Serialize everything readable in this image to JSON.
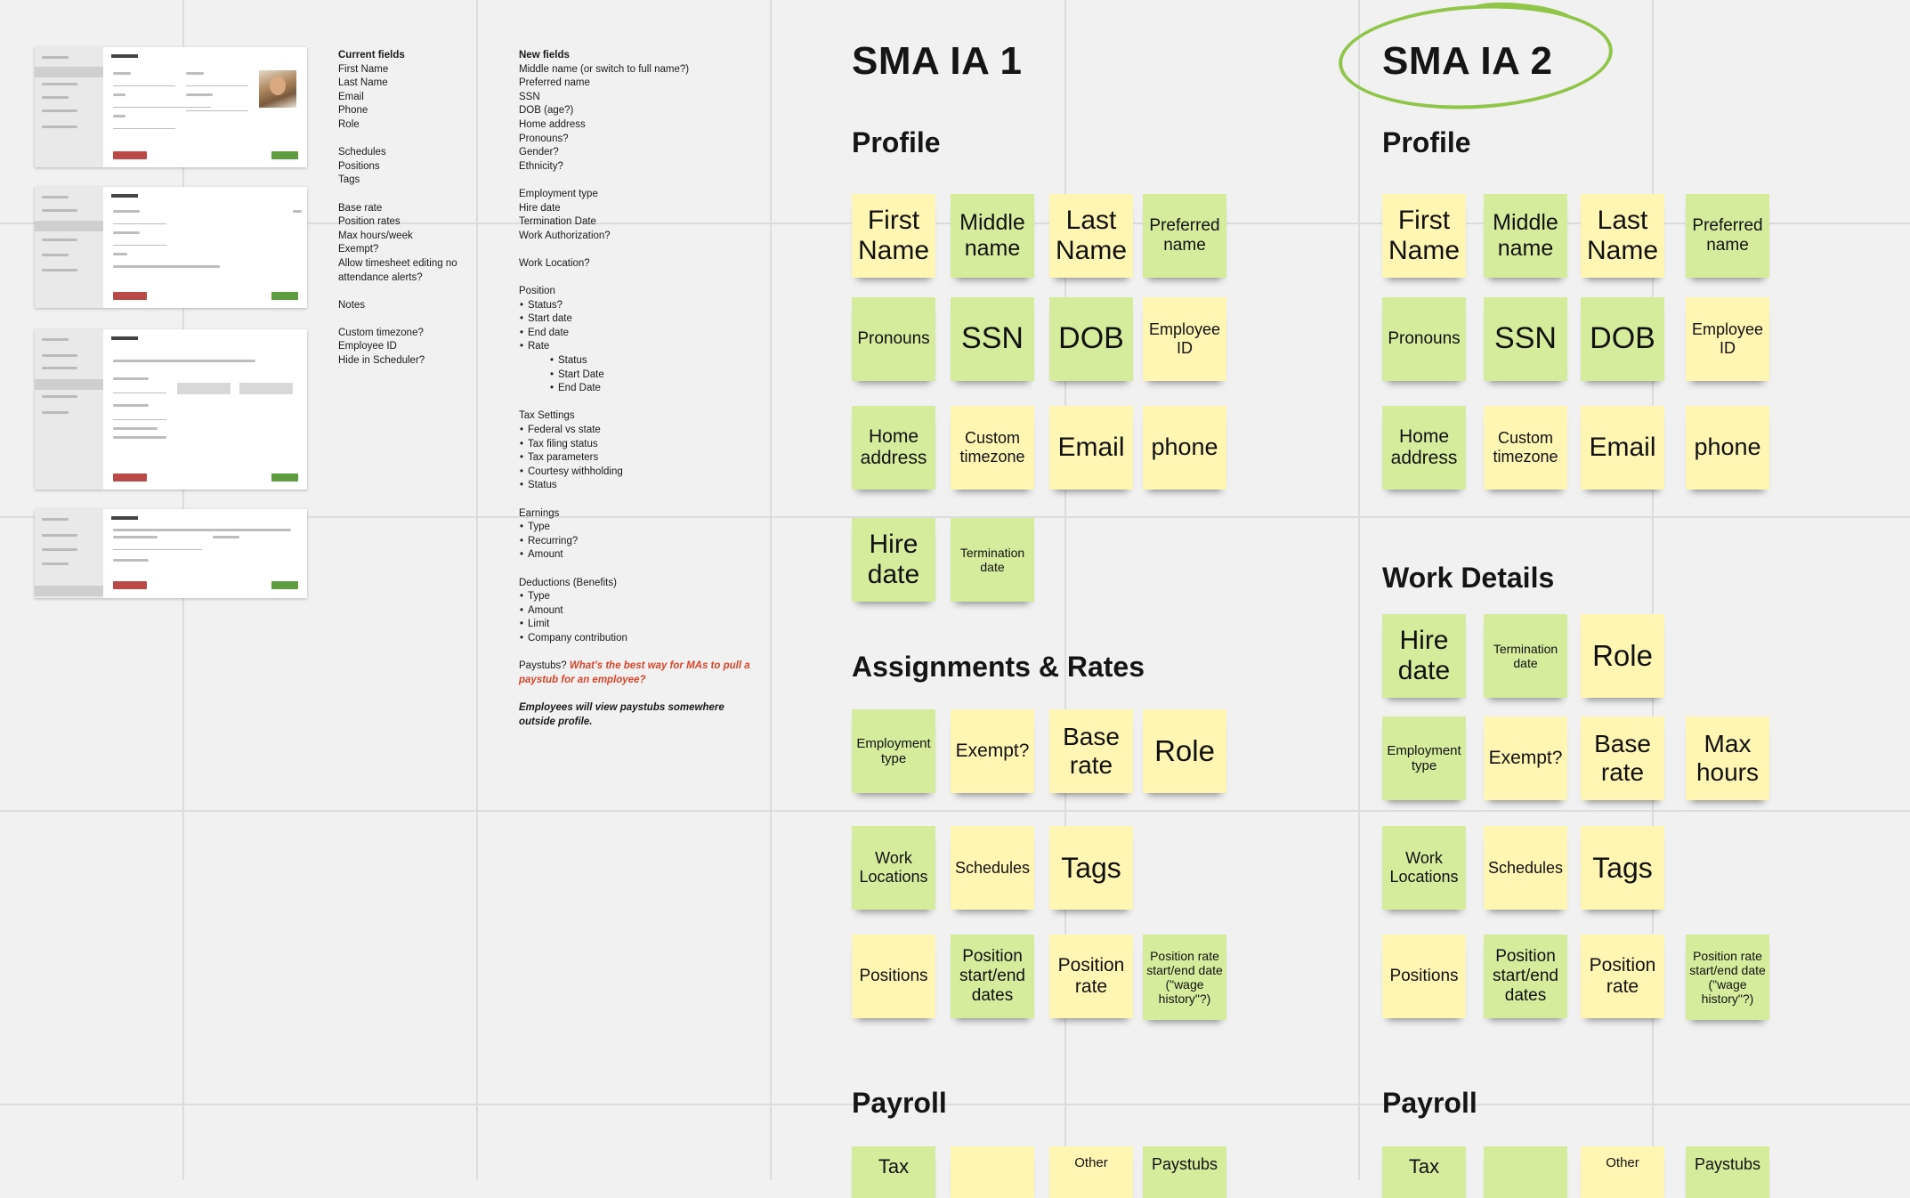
{
  "thumbnails": [
    "profile-form",
    "position-form",
    "rate-form",
    "tags-form"
  ],
  "current_fields": {
    "title": "Current fields",
    "items": [
      "First Name",
      "Last Name",
      "Email",
      "Phone",
      "Role",
      "",
      "Schedules",
      "Positions",
      "Tags",
      "",
      "Base rate",
      "Position rates",
      "Max hours/week",
      "Exempt?",
      "Allow timesheet editing no",
      "attendance alerts?",
      "",
      "Notes",
      "",
      "Custom timezone?",
      "Employee ID",
      "Hide in Scheduler?"
    ]
  },
  "new_fields": {
    "title": "New fields",
    "lines": [
      {
        "t": "Middle name (or switch to full name?)"
      },
      {
        "t": "Preferred name"
      },
      {
        "t": "SSN"
      },
      {
        "t": "DOB (age?)"
      },
      {
        "t": "Home address"
      },
      {
        "t": "Pronouns?"
      },
      {
        "t": "Gender?"
      },
      {
        "t": "Ethnicity?"
      },
      {
        "t": ""
      },
      {
        "t": "Employment type"
      },
      {
        "t": "Hire date"
      },
      {
        "t": "Termination Date"
      },
      {
        "t": "Work Authorization?"
      },
      {
        "t": ""
      },
      {
        "t": "Work Location?"
      },
      {
        "t": ""
      },
      {
        "t": "Position"
      },
      {
        "t": "Status?",
        "b": 1
      },
      {
        "t": "Start date",
        "b": 1
      },
      {
        "t": "End date",
        "b": 1
      },
      {
        "t": "Rate",
        "b": 1
      },
      {
        "t": "Status",
        "b": 2
      },
      {
        "t": "Start Date",
        "b": 2
      },
      {
        "t": "End Date",
        "b": 2
      },
      {
        "t": ""
      },
      {
        "t": "Tax Settings"
      },
      {
        "t": "Federal vs state",
        "b": 1
      },
      {
        "t": "Tax filing status",
        "b": 1
      },
      {
        "t": "Tax parameters",
        "b": 1
      },
      {
        "t": "Courtesy withholding",
        "b": 1
      },
      {
        "t": "Status",
        "b": 1
      },
      {
        "t": ""
      },
      {
        "t": "Earnings"
      },
      {
        "t": "Type",
        "b": 1
      },
      {
        "t": "Recurring?",
        "b": 1
      },
      {
        "t": "Amount",
        "b": 1
      },
      {
        "t": ""
      },
      {
        "t": "Deductions (Benefits)"
      },
      {
        "t": "Type",
        "b": 1
      },
      {
        "t": "Amount",
        "b": 1
      },
      {
        "t": "Limit",
        "b": 1
      },
      {
        "t": "Company contribution",
        "b": 1
      }
    ],
    "paystubs_label": "Paystubs?",
    "paystubs_question": "What's the best way for MAs to pull a paystub for an employee?",
    "employees_note": "Employees will view paystubs somewhere outside profile."
  },
  "ia1": {
    "title": "SMA IA 1",
    "sections": [
      "Profile",
      "Assignments & Rates",
      "Payroll"
    ]
  },
  "ia2": {
    "title": "SMA IA 2",
    "sections": [
      "Profile",
      "Work Details",
      "Payroll"
    ]
  },
  "colors": {
    "green_note": "#d5ec9c",
    "yellow_note": "#fff6b4",
    "highlight_circle": "#8fc64a",
    "red_text": "#d9462a"
  },
  "notes": [
    {
      "text": "First Name",
      "c": "y",
      "fs": 30,
      "col": 0,
      "row": 0
    },
    {
      "text": "Middle name",
      "c": "g",
      "fs": 25,
      "col": 1,
      "row": 0
    },
    {
      "text": "Last Name",
      "c": "y",
      "fs": 30,
      "col": 2,
      "row": 0
    },
    {
      "text": "Preferred name",
      "c": "g",
      "fs": 19,
      "col": 3,
      "row": 0
    },
    {
      "text": "Pronouns",
      "c": "g",
      "fs": 19,
      "col": 0,
      "row": 1
    },
    {
      "text": "SSN",
      "c": "g",
      "fs": 34,
      "col": 1,
      "row": 1
    },
    {
      "text": "DOB",
      "c": "g",
      "fs": 34,
      "col": 2,
      "row": 1
    },
    {
      "text": "Employee ID",
      "c": "y",
      "fs": 18,
      "col": 3,
      "row": 1
    },
    {
      "text": "Home address",
      "c": "g",
      "fs": 21,
      "col": 0,
      "row": 2
    },
    {
      "text": "Custom timezone",
      "c": "y",
      "fs": 18,
      "col": 1,
      "row": 2
    },
    {
      "text": "Email",
      "c": "y",
      "fs": 30,
      "col": 2,
      "row": 2
    },
    {
      "text": "phone",
      "c": "y",
      "fs": 27,
      "col": 3,
      "row": 2
    },
    {
      "text": "Hire date",
      "c": "g",
      "fs": 30,
      "set": "ia1",
      "col": 0,
      "row": 3
    },
    {
      "text": "Termination date",
      "c": "g",
      "fs": 14,
      "set": "ia1",
      "col": 1,
      "row": 3
    },
    {
      "text": "Employment type",
      "c": "g",
      "fs": 15,
      "set": "ia1",
      "col": 0,
      "row": 4
    },
    {
      "text": "Exempt?",
      "c": "y",
      "fs": 21,
      "set": "ia1",
      "col": 1,
      "row": 4
    },
    {
      "text": "Base rate",
      "c": "y",
      "fs": 28,
      "set": "ia1",
      "col": 2,
      "row": 4
    },
    {
      "text": "Role",
      "c": "y",
      "fs": 33,
      "set": "ia1",
      "col": 3,
      "row": 4
    },
    {
      "text": "Work Locations",
      "c": "g",
      "fs": 18,
      "set": "ia1",
      "col": 0,
      "row": 5
    },
    {
      "text": "Schedules",
      "c": "y",
      "fs": 18,
      "set": "ia1",
      "col": 1,
      "row": 5
    },
    {
      "text": "Tags",
      "c": "y",
      "fs": 32,
      "set": "ia1",
      "col": 2,
      "row": 5
    },
    {
      "text": "Positions",
      "c": "y",
      "fs": 19,
      "set": "ia1",
      "col": 0,
      "row": 6
    },
    {
      "text": "Position start/end dates",
      "c": "g",
      "fs": 19,
      "set": "ia1",
      "col": 1,
      "row": 6
    },
    {
      "text": "Position rate",
      "c": "y",
      "fs": 21,
      "set": "ia1",
      "col": 2,
      "row": 6
    },
    {
      "text": "Position rate start/end date (\"wage history\"?)",
      "c": "g",
      "fs": 14,
      "set": "ia1",
      "col": 3,
      "row": 6
    },
    {
      "text": "Tax",
      "c": "g",
      "fs": 22,
      "set": "ia1",
      "col": 0,
      "row": 7
    },
    {
      "text": "",
      "c": "y",
      "fs": 18,
      "set": "ia1",
      "col": 1,
      "row": 7
    },
    {
      "text": "Other",
      "c": "y",
      "fs": 15,
      "set": "ia1",
      "col": 2,
      "row": 7
    },
    {
      "text": "Paystubs",
      "c": "g",
      "fs": 18,
      "set": "ia1",
      "col": 3,
      "row": 7
    },
    {
      "text": "Hire date",
      "c": "g",
      "fs": 30,
      "set": "ia2",
      "col": 0,
      "row": 3
    },
    {
      "text": "Termination date",
      "c": "g",
      "fs": 14,
      "set": "ia2",
      "col": 1,
      "row": 3
    },
    {
      "text": "Role",
      "c": "y",
      "fs": 33,
      "set": "ia2",
      "col": 2,
      "row": 3
    },
    {
      "text": "Employment type",
      "c": "g",
      "fs": 15,
      "set": "ia2",
      "col": 0,
      "row": 4
    },
    {
      "text": "Exempt?",
      "c": "y",
      "fs": 21,
      "set": "ia2",
      "col": 1,
      "row": 4
    },
    {
      "text": "Base rate",
      "c": "y",
      "fs": 28,
      "set": "ia2",
      "col": 2,
      "row": 4
    },
    {
      "text": "Max hours",
      "c": "y",
      "fs": 28,
      "set": "ia2",
      "col": 3,
      "row": 4
    },
    {
      "text": "Work Locations",
      "c": "g",
      "fs": 18,
      "set": "ia2",
      "col": 0,
      "row": 5
    },
    {
      "text": "Schedules",
      "c": "y",
      "fs": 18,
      "set": "ia2",
      "col": 1,
      "row": 5
    },
    {
      "text": "Tags",
      "c": "y",
      "fs": 32,
      "set": "ia2",
      "col": 2,
      "row": 5
    },
    {
      "text": "Positions",
      "c": "y",
      "fs": 19,
      "set": "ia2",
      "col": 0,
      "row": 6
    },
    {
      "text": "Position start/end dates",
      "c": "g",
      "fs": 19,
      "set": "ia2",
      "col": 1,
      "row": 6
    },
    {
      "text": "Position rate",
      "c": "y",
      "fs": 21,
      "set": "ia2",
      "col": 2,
      "row": 6
    },
    {
      "text": "Position rate start/end date (\"wage history\"?)",
      "c": "g",
      "fs": 14,
      "set": "ia2",
      "col": 3,
      "row": 6
    },
    {
      "text": "Tax",
      "c": "g",
      "fs": 22,
      "set": "ia2",
      "col": 0,
      "row": 7
    },
    {
      "text": "",
      "c": "g",
      "fs": 18,
      "set": "ia2",
      "col": 1,
      "row": 7
    },
    {
      "text": "Other",
      "c": "y",
      "fs": 15,
      "set": "ia2",
      "col": 2,
      "row": 7
    },
    {
      "text": "Paystubs",
      "c": "g",
      "fs": 18,
      "set": "ia2",
      "col": 3,
      "row": 7
    }
  ]
}
